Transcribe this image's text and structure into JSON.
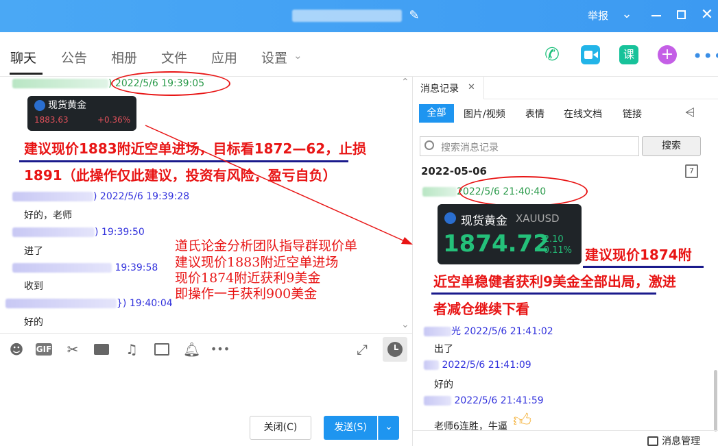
{
  "titlebar": {
    "report_label": "举报"
  },
  "tabs": [
    {
      "label": "聊天"
    },
    {
      "label": "公告"
    },
    {
      "label": "相册"
    },
    {
      "label": "文件"
    },
    {
      "label": "应用"
    },
    {
      "label": "设置"
    }
  ],
  "header_icons": {
    "course_label": "课"
  },
  "chat": {
    "first_time": ") 2022/5/6 19:39:05",
    "card_small": {
      "name": "现货黄金",
      "price": "1883.63",
      "change": "+0.36%"
    },
    "red_line1": "建议现价1883附近空单进场，目标看1872—62，止损",
    "red_line2": "1891（此操作仅此建议，投资有风险，盈亏自负）",
    "messages": [
      {
        "time": ") 2022/5/6 19:39:28",
        "text": "好的，老师"
      },
      {
        "time": ")  19:39:50",
        "text": "进了"
      },
      {
        "time": "19:39:58",
        "text": "收到"
      },
      {
        "time": "})  19:40:04",
        "text": "好的"
      }
    ],
    "annotation": [
      "道氏论金分析团队指导群现价单",
      "建议现价1883附近空单进场",
      "现价1874附近获利9美金",
      "即操作一手获利900美金"
    ]
  },
  "compose": {
    "close_label": "关闭(C)",
    "send_label": "发送(S)"
  },
  "history": {
    "title": "消息记录",
    "filters": [
      "全部",
      "图片/视频",
      "表情",
      "在线文档",
      "链接"
    ],
    "search_placeholder": "搜索消息记录",
    "search_button": "搜索",
    "date": "2022-05-06",
    "calendar_day": "7",
    "first_time": "2022/5/6 21:40:40",
    "card_big": {
      "name": "现货黄金",
      "symbol": "XAUUSD",
      "price": "1874.72",
      "change": "-2.10",
      "percent": "-0.11%"
    },
    "red_lines": [
      "建议现价1874附",
      "近空单稳健者获利9美金全部出局，激进",
      "者减仓继续下看"
    ],
    "messages": [
      {
        "time": "光 2022/5/6 21:41:02",
        "text": "出了"
      },
      {
        "time": "2022/5/6 21:41:09",
        "text": "好的"
      },
      {
        "time": "2022/5/6 21:41:59",
        "text": "老师6连胜，牛逼"
      }
    ],
    "manage_label": "消息管理"
  }
}
